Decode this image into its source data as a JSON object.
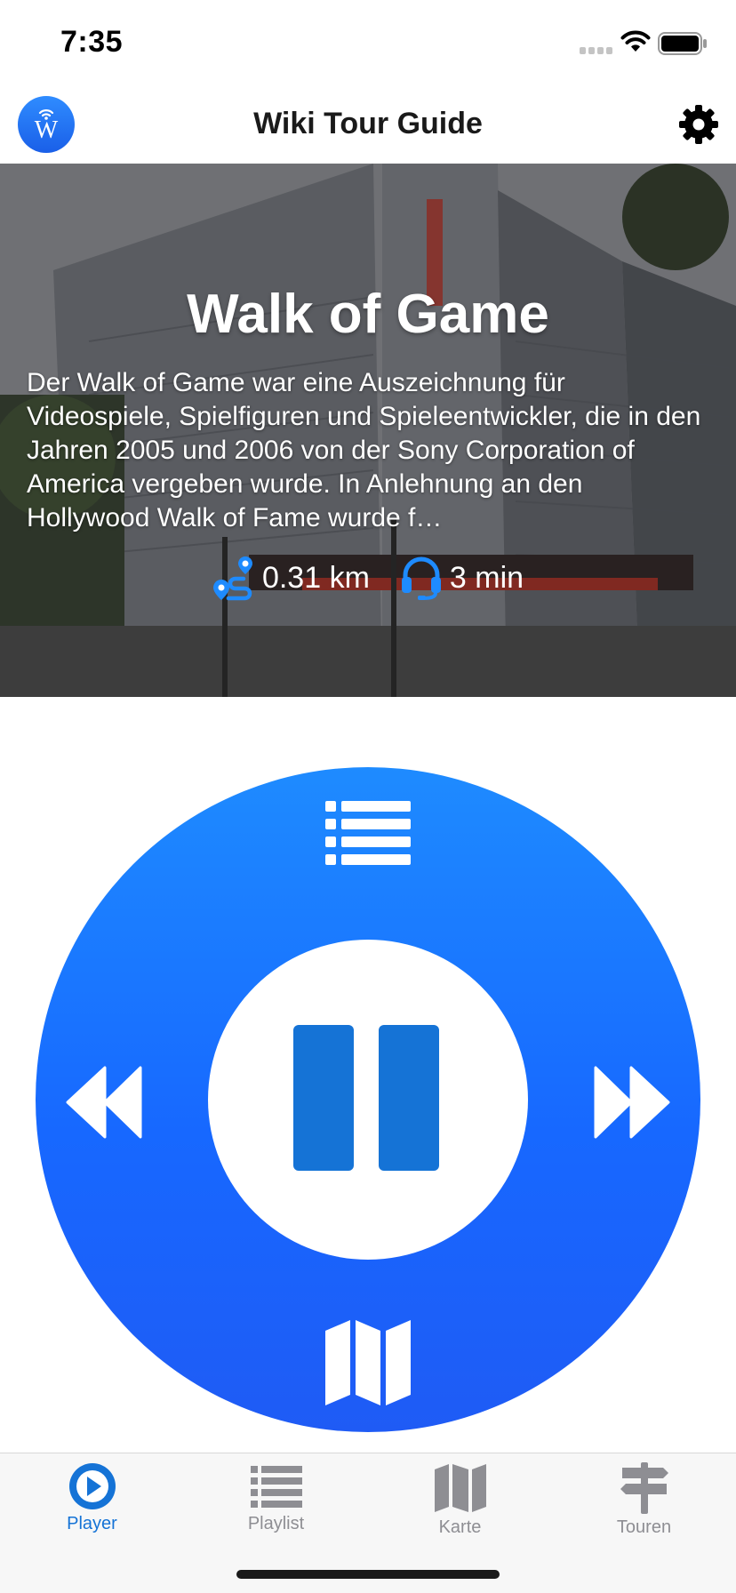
{
  "status_bar": {
    "time": "7:35"
  },
  "nav": {
    "title": "Wiki Tour Guide",
    "logo_letter": "W"
  },
  "hero": {
    "title": "Walk of Game",
    "description": "Der Walk of Game war eine Auszeichnung für Videospiele, Spielfiguren und Spieleentwickler, die in den Jahren 2005 und 2006 von der Sony Corporation of America vergeben wurde. In Anlehnung an den Hollywood Walk of Fame wurde f…",
    "distance": "0.31 km",
    "duration": "3 min"
  },
  "player": {
    "state": "playing",
    "icons": {
      "top": "list-icon",
      "left": "rewind-icon",
      "center": "pause-icon",
      "right": "fast-forward-icon",
      "bottom": "map-icon"
    }
  },
  "tabs": [
    {
      "label": "Player",
      "icon": "play-circle-icon",
      "active": true
    },
    {
      "label": "Playlist",
      "icon": "list-icon",
      "active": false
    },
    {
      "label": "Karte",
      "icon": "map-icon",
      "active": false
    },
    {
      "label": "Touren",
      "icon": "signpost-icon",
      "active": false
    }
  ],
  "colors": {
    "accent": "#1573d6",
    "wheel_top": "#1e8bff",
    "wheel_bottom": "#1f5bf5",
    "tab_inactive": "#8e8e93"
  }
}
